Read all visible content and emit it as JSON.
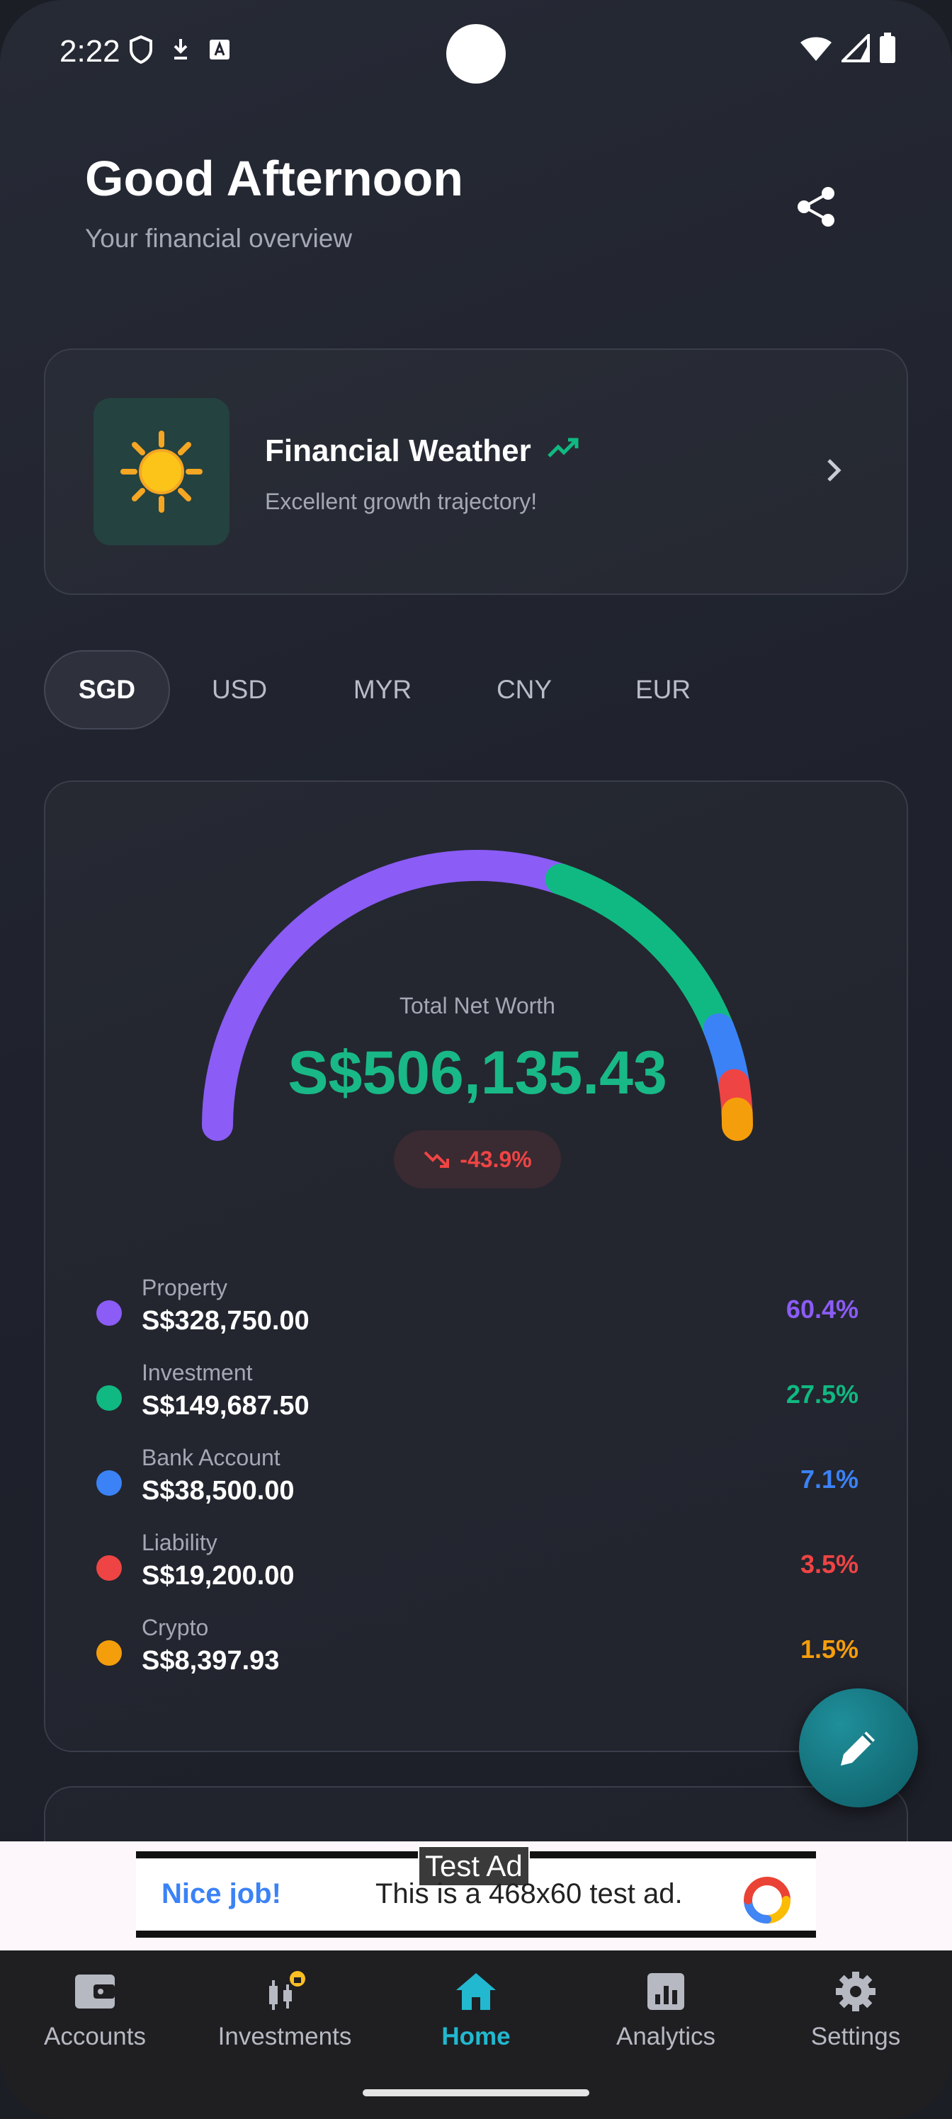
{
  "status_bar": {
    "time": "2:22"
  },
  "header": {
    "greeting": "Good Afternoon",
    "subtitle": "Your financial overview"
  },
  "weather": {
    "title": "Financial Weather",
    "description": "Excellent growth trajectory!",
    "icon": "sun-icon"
  },
  "currencies": {
    "tabs": [
      "SGD",
      "USD",
      "MYR",
      "CNY",
      "EUR"
    ],
    "selected": "SGD"
  },
  "net_worth": {
    "label": "Total Net Worth",
    "value": "S$506,135.43",
    "change": "-43.9%",
    "breakdown": [
      {
        "name": "Property",
        "value": "S$328,750.00",
        "percent": "60.4%",
        "share": 60.4,
        "color": "#8b5cf6"
      },
      {
        "name": "Investment",
        "value": "S$149,687.50",
        "percent": "27.5%",
        "share": 27.5,
        "color": "#10b981"
      },
      {
        "name": "Bank Account",
        "value": "S$38,500.00",
        "percent": "7.1%",
        "share": 7.1,
        "color": "#3b82f6"
      },
      {
        "name": "Liability",
        "value": "S$19,200.00",
        "percent": "3.5%",
        "share": 3.5,
        "color": "#ef4444"
      },
      {
        "name": "Crypto",
        "value": "S$8,397.93",
        "percent": "1.5%",
        "share": 1.5,
        "color": "#f59e0b"
      }
    ],
    "value_color": "#19b887",
    "change_color": "#ef4444"
  },
  "ad": {
    "tag": "Test Ad",
    "cta": "Nice job!",
    "text": "This is a 468x60 test ad."
  },
  "bottom_nav": {
    "items": [
      {
        "label": "Accounts",
        "icon": "wallet-icon"
      },
      {
        "label": "Investments",
        "icon": "investments-icon"
      },
      {
        "label": "Home",
        "icon": "home-icon"
      },
      {
        "label": "Analytics",
        "icon": "analytics-icon"
      },
      {
        "label": "Settings",
        "icon": "gear-icon"
      }
    ],
    "active": "Home",
    "active_color": "#22b8cf"
  }
}
